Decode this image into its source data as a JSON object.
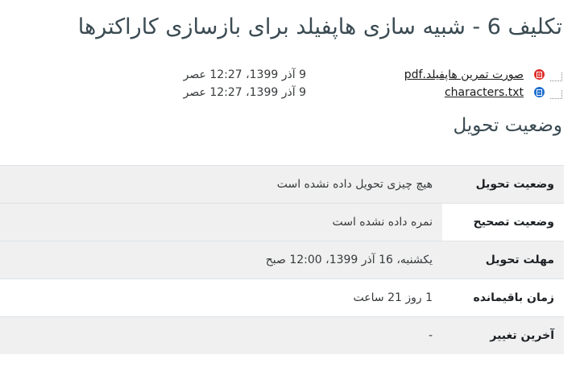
{
  "page": {
    "title": "تکلیف 6 - شبیه سازی هاپفیلد برای بازسازی کاراکترها"
  },
  "files": [
    {
      "name": "صورت تمرین هاپفیلد.pdf",
      "icon": "pdf-icon",
      "icon_color": "#e02b27",
      "modified": "9 آذر 1399، 12:27 عصر"
    },
    {
      "name": "characters.txt",
      "icon": "text-file-icon",
      "icon_color": "#1f6fcf",
      "modified": "9 آذر 1399، 12:27 عصر"
    }
  ],
  "submission": {
    "heading": "وضعیت تحویل",
    "rows": [
      {
        "label": "وضعیت تحویل",
        "value": "هیچ چیزی تحویل داده نشده است"
      },
      {
        "label": "وضعیت تصحیح",
        "value": "نمره داده نشده است"
      },
      {
        "label": "مهلت تحویل",
        "value": "یکشنبه، 16 آذر 1399، 12:00 صبح"
      },
      {
        "label": "زمان باقیمانده",
        "value": "1 روز 21 ساعت"
      },
      {
        "label": "آخرین تغییر",
        "value": "-"
      }
    ]
  }
}
